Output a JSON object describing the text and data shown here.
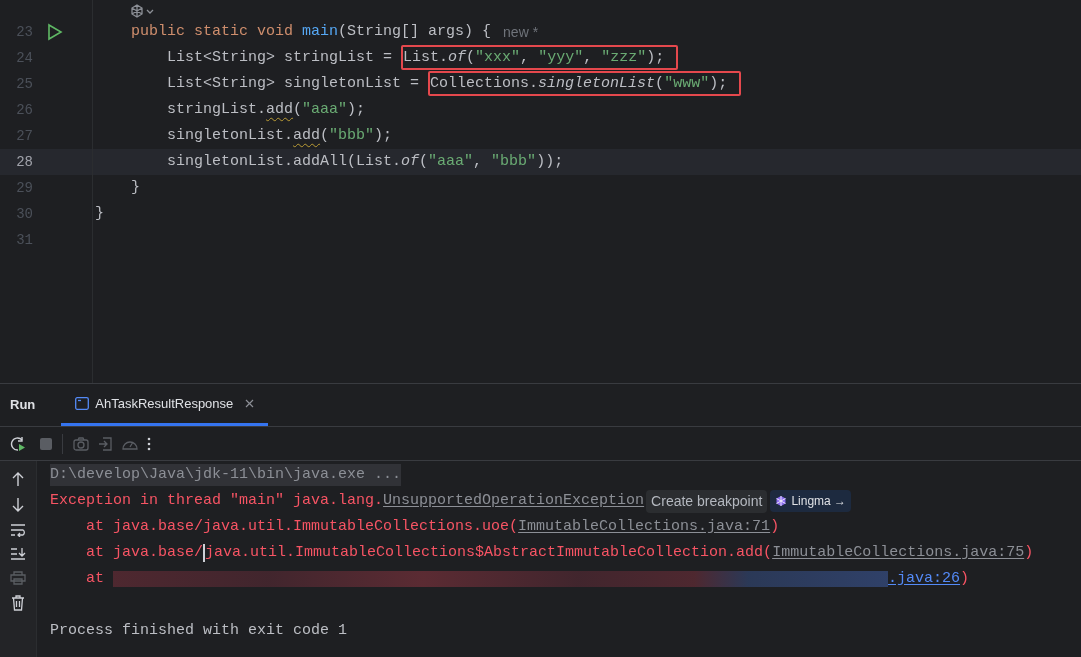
{
  "editor": {
    "lines": [
      {
        "number": "23",
        "run_gutter": true,
        "current": false,
        "tokens": [
          {
            "text": "public static void ",
            "kind": "keyword"
          },
          {
            "text": "main",
            "kind": "method"
          },
          {
            "text": "(String[] args) {",
            "kind": "plain"
          }
        ],
        "hint": "new *"
      },
      {
        "number": "24",
        "run_gutter": false,
        "current": false,
        "tokens": [
          {
            "text": "List<String> stringList = ",
            "kind": "plain"
          },
          {
            "boxed": true,
            "tokens": [
              {
                "text": "List.",
                "kind": "plain"
              },
              {
                "text": "of",
                "kind": "static"
              },
              {
                "text": "(",
                "kind": "plain"
              },
              {
                "text": "\"xxx\"",
                "kind": "string"
              },
              {
                "text": ", ",
                "kind": "plain"
              },
              {
                "text": "\"yyy\"",
                "kind": "string"
              },
              {
                "text": ", ",
                "kind": "plain"
              },
              {
                "text": "\"zzz\"",
                "kind": "string"
              },
              {
                "text": ");",
                "kind": "plain"
              }
            ]
          }
        ]
      },
      {
        "number": "25",
        "run_gutter": false,
        "current": false,
        "tokens": [
          {
            "text": "List<String> singletonList = ",
            "kind": "plain"
          },
          {
            "boxed": true,
            "tokens": [
              {
                "text": "Collections.",
                "kind": "plain"
              },
              {
                "text": "singletonList",
                "kind": "static"
              },
              {
                "text": "(",
                "kind": "plain"
              },
              {
                "text": "\"www\"",
                "kind": "string"
              },
              {
                "text": ");",
                "kind": "plain"
              }
            ]
          }
        ]
      },
      {
        "number": "26",
        "run_gutter": false,
        "current": false,
        "tokens": [
          {
            "text": "stringList.",
            "kind": "plain"
          },
          {
            "text": "add",
            "kind": "warning"
          },
          {
            "text": "(",
            "kind": "plain"
          },
          {
            "text": "\"aaa\"",
            "kind": "string"
          },
          {
            "text": ");",
            "kind": "plain"
          }
        ]
      },
      {
        "number": "27",
        "run_gutter": false,
        "current": false,
        "tokens": [
          {
            "text": "singletonList.",
            "kind": "plain"
          },
          {
            "text": "add",
            "kind": "warning"
          },
          {
            "text": "(",
            "kind": "plain"
          },
          {
            "text": "\"bbb\"",
            "kind": "string"
          },
          {
            "text": ");",
            "kind": "plain"
          }
        ]
      },
      {
        "number": "28",
        "run_gutter": false,
        "current": true,
        "tokens": [
          {
            "text": "singletonList.addAll(List.",
            "kind": "plain"
          },
          {
            "text": "of",
            "kind": "static"
          },
          {
            "text": "(",
            "kind": "plain"
          },
          {
            "text": "\"aaa\"",
            "kind": "string"
          },
          {
            "text": ", ",
            "kind": "plain"
          },
          {
            "text": "\"bbb\"",
            "kind": "string"
          },
          {
            "text": "));",
            "kind": "plain"
          }
        ]
      },
      {
        "number": "29",
        "run_gutter": false,
        "current": false,
        "tokens": [
          {
            "text": "}",
            "kind": "plain"
          }
        ]
      },
      {
        "number": "30",
        "run_gutter": false,
        "current": false,
        "tokens": [
          {
            "text": "}",
            "kind": "plain"
          }
        ]
      },
      {
        "number": "31",
        "run_gutter": false,
        "current": false
      }
    ]
  },
  "run_panel": {
    "title": "Run",
    "tabs": [
      {
        "label": "AhTaskResultResponse",
        "selected": true
      }
    ],
    "console": [
      {
        "kind": "message",
        "tokens": [
          {
            "text": "D:\\develop\\Java\\jdk-11\\bin\\java.exe ...",
            "kind": "command"
          }
        ]
      },
      {
        "kind": "message",
        "tokens": [
          {
            "text": "Exception in thread \"main\" java.lang.",
            "kind": "error"
          },
          {
            "text": "UnsupportedOperationException",
            "kind": "link"
          },
          {
            "text": "Create breakpoint",
            "kind": "chip"
          },
          {
            "text": "Lingma →",
            "kind": "ai_chip"
          }
        ]
      },
      {
        "kind": "stack_frame",
        "tokens": [
          {
            "text": "at java.base/java.util.ImmutableCollections.uoe(",
            "kind": "error"
          },
          {
            "text": "ImmutableCollections.java:71",
            "kind": "link"
          },
          {
            "text": ")",
            "kind": "error"
          }
        ]
      },
      {
        "kind": "stack_frame",
        "tokens": [
          {
            "text": "at java.base/",
            "kind": "error"
          },
          {
            "kind": "caret"
          },
          {
            "text": "java.util.ImmutableCollections$AbstractImmutableCollection.add(",
            "kind": "error"
          },
          {
            "text": "ImmutableCollections.java:75",
            "kind": "link"
          },
          {
            "text": ")",
            "kind": "error"
          }
        ]
      },
      {
        "kind": "stack_frame",
        "tokens": [
          {
            "text": "at ",
            "kind": "error"
          },
          {
            "kind": "redacted"
          },
          {
            "text": ".java:26",
            "kind": "source_link"
          },
          {
            "text": ")",
            "kind": "error"
          }
        ]
      },
      {
        "kind": "blank"
      },
      {
        "kind": "message",
        "tokens": [
          {
            "text": "Process finished with exit code 1",
            "kind": "plain"
          }
        ]
      }
    ]
  }
}
